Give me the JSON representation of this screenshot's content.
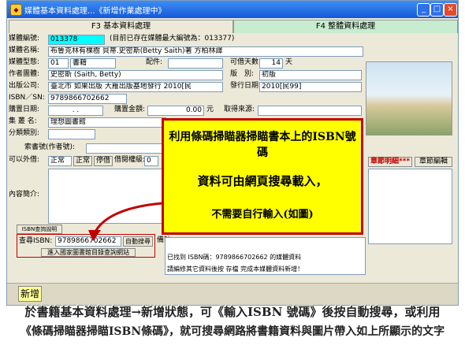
{
  "window": {
    "title": "媒體基本資料處理...《新增作業處理中》"
  },
  "tabs": {
    "active": "F3 基本資料處理",
    "inactive": "F4 整體資料處理"
  },
  "form": {
    "media_no_label": "媒體編號:",
    "media_no_value": "013378",
    "media_no_note": "(目前已存在媒體最大編號為：013377)",
    "media_name_label": "媒體名稱:",
    "media_name_value": "布魯克林有棵樹 貝蒂.史密斯(Betty Saith)著 方柏林譯",
    "media_type_label": "媒體型態:",
    "media_type_code": "01",
    "media_type_name": "書籍",
    "accessory_label": "配件:",
    "loan_days_label": "可借天數:",
    "loan_days_value": "14",
    "loan_days_unit": "天",
    "author_label": "作者團體:",
    "author_value": "史密斯 (Saith, Betty)",
    "edition_label": "版　別:",
    "edition_value": "初版",
    "publisher_label": "出版公司:",
    "publisher_value": "臺北市 如果出版 大雁出版基地發行 2010[民",
    "year_label": "發行日期:",
    "year_value": "2010[民99]",
    "isbn_label": "ISBN／SN:",
    "isbn_value": "9789866702662",
    "purchase_date_label": "購置日期:",
    "purchase_date_value": ". .",
    "amount_label": "購置金額:",
    "amount_value": "0.00",
    "amount_unit": "元",
    "source_label": "取得來源:",
    "collection_label": "集 叢 名:",
    "collection_value": "理想圖書館",
    "category_label": "分類類別:",
    "callno_label": "索書號(作者號):",
    "loanable_label": "可以外借:",
    "loanable_value": "正常",
    "normal_btn": "正常",
    "stop_btn": "停借",
    "level_label": "借閱權級:",
    "level_value": "0",
    "intro_label": "內容簡介:",
    "isbn_query_btn": "ISBN查詢說明",
    "chapter_btn": "章節明細***",
    "chapter_edit_btn": "章節編輯",
    "import_btn": "匯"
  },
  "query": {
    "isbn_label": "查尋ISBN:",
    "isbn_value": "9789866702662",
    "auto_btn": "自動搜尋",
    "link_btn": "進入國家圖書館目錄查詢網站",
    "result_line1": "已找到 ISBN碼：9789866702662 的媒體資料",
    "result_line2": "請編修其它資料後按 存檔 完成本媒體資料新增！",
    "remark_label": "備註"
  },
  "bottom": {
    "new_btn": "新增"
  },
  "callout": {
    "line1": "利用條碼掃瞄器掃瞄書本上的ISBN號碼",
    "line2": "資料可由網頁搜尋載入，",
    "line3": "不需要自行輸入(如圖)"
  },
  "caption": {
    "line1": "於書籍基本資料處理→新增狀態，可《輸入ISBN 號碼》後按自動搜尋，或利用",
    "line2": "《條碼掃瞄器掃瞄ISBN條碼》，就可搜尋網路將書籍資料與圖片帶入如上所顯示的文字"
  },
  "colors": {
    "cyan": "#00ffff",
    "yellow": "#ffff00",
    "red": "#c00000",
    "magenta": "#ff00ff"
  }
}
